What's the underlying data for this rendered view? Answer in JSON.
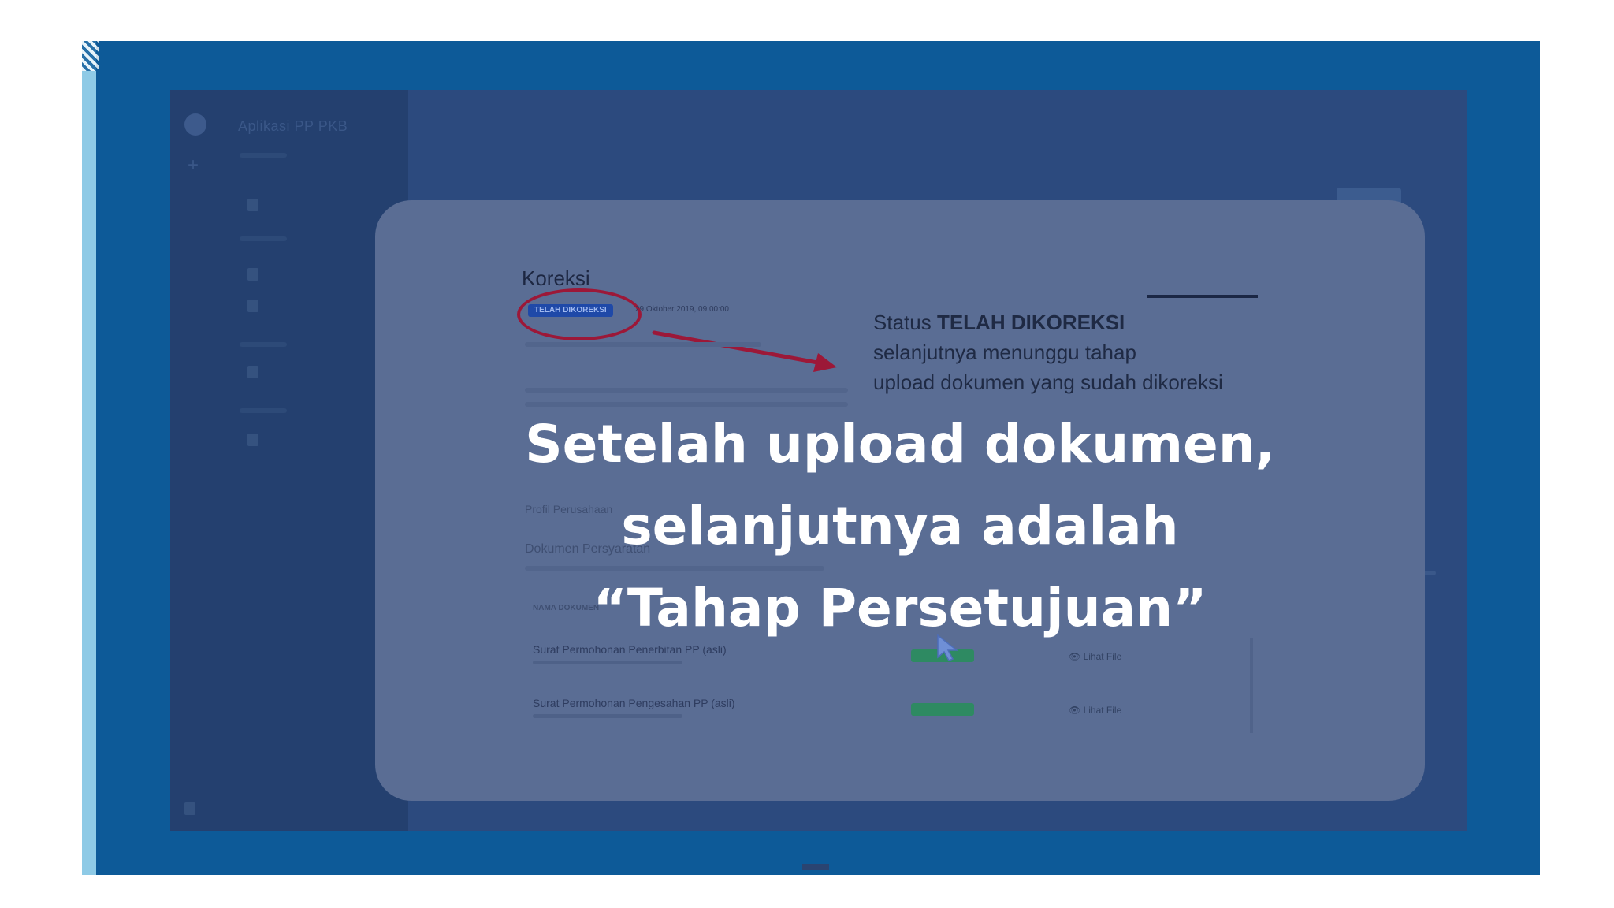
{
  "card": {
    "doc_title": "Koreksi",
    "status_badge": "TELAH DIKOREKSI",
    "status_date": "29 Oktober 2019, 09:00:00",
    "annotation": {
      "line1_prefix": "Status ",
      "line1_bold": "TELAH DIKOREKSI",
      "line2": "selanjutnya menunggu tahap",
      "line3": "upload dokumen yang sudah dikoreksi"
    },
    "headline": {
      "line1": "Setelah upload dokumen,",
      "line2": "selanjutnya adalah",
      "line3": "“Tahap Persetujuan”"
    },
    "documents": {
      "section_profile": "Profil Perusahaan",
      "section_title": "Dokumen Persyaratan",
      "column_header": "NAMA DOKUMEN",
      "rows": [
        {
          "name": "Surat Permohonan Penerbitan PP (asli)",
          "view": "Lihat File"
        },
        {
          "name": "Surat Permohonan Pengesahan PP (asli)",
          "view": "Lihat File"
        }
      ]
    }
  },
  "background_app": {
    "app_title": "Aplikasi PP PKB"
  },
  "colors": {
    "frame": "#0d5a98",
    "card": "#5a6d94",
    "circle": "#9c1838",
    "badge": "#1f49a8"
  }
}
